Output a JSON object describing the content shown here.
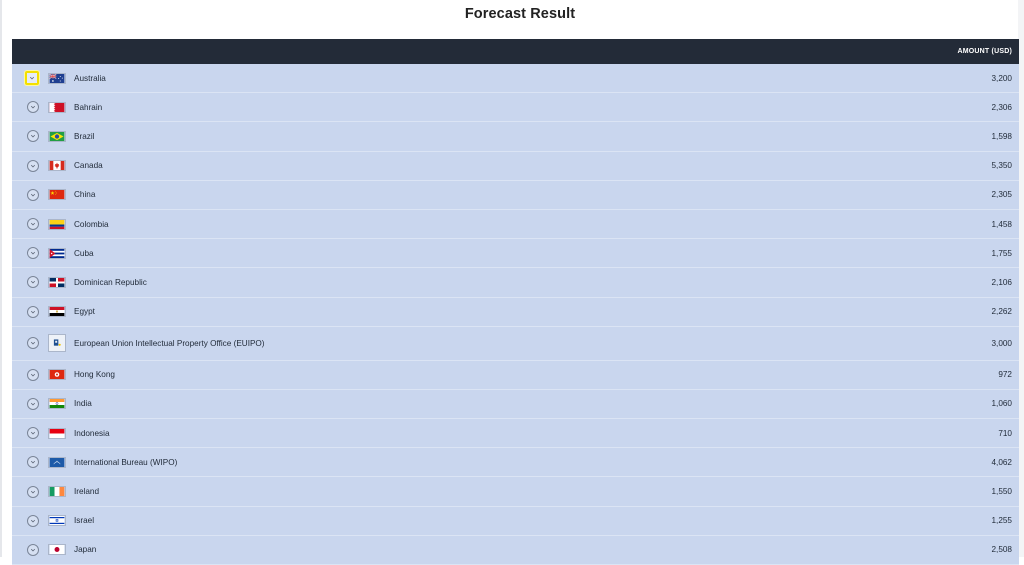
{
  "title": "Forecast Result",
  "table": {
    "amount_header": "AMOUNT (USD)",
    "rows": [
      {
        "country": "Australia",
        "amount": "3,200",
        "flag": "australia-flag"
      },
      {
        "country": "Bahrain",
        "amount": "2,306",
        "flag": "bahrain-flag"
      },
      {
        "country": "Brazil",
        "amount": "1,598",
        "flag": "brazil-flag"
      },
      {
        "country": "Canada",
        "amount": "5,350",
        "flag": "canada-flag"
      },
      {
        "country": "China",
        "amount": "2,305",
        "flag": "china-flag"
      },
      {
        "country": "Colombia",
        "amount": "1,458",
        "flag": "colombia-flag"
      },
      {
        "country": "Cuba",
        "amount": "1,755",
        "flag": "cuba-flag"
      },
      {
        "country": "Dominican Republic",
        "amount": "2,106",
        "flag": "dominican-republic-flag"
      },
      {
        "country": "Egypt",
        "amount": "2,262",
        "flag": "egypt-flag"
      },
      {
        "country": "European Union Intellectual Property Office (EUIPO)",
        "amount": "3,000",
        "flag": "euipo-logo"
      },
      {
        "country": "Hong Kong",
        "amount": "972",
        "flag": "hong-kong-flag"
      },
      {
        "country": "India",
        "amount": "1,060",
        "flag": "india-flag"
      },
      {
        "country": "Indonesia",
        "amount": "710",
        "flag": "indonesia-flag"
      },
      {
        "country": "International Bureau (WIPO)",
        "amount": "4,062",
        "flag": "wipo-flag"
      },
      {
        "country": "Ireland",
        "amount": "1,550",
        "flag": "ireland-flag"
      },
      {
        "country": "Israel",
        "amount": "1,255",
        "flag": "israel-flag"
      },
      {
        "country": "Japan",
        "amount": "2,508",
        "flag": "japan-flag"
      }
    ]
  },
  "colors": {
    "header_bg": "#232b38",
    "row_bg": "#c9d6ee",
    "focus_outline": "#f4e000"
  },
  "icons": {
    "expand": "chevron-down-icon"
  }
}
